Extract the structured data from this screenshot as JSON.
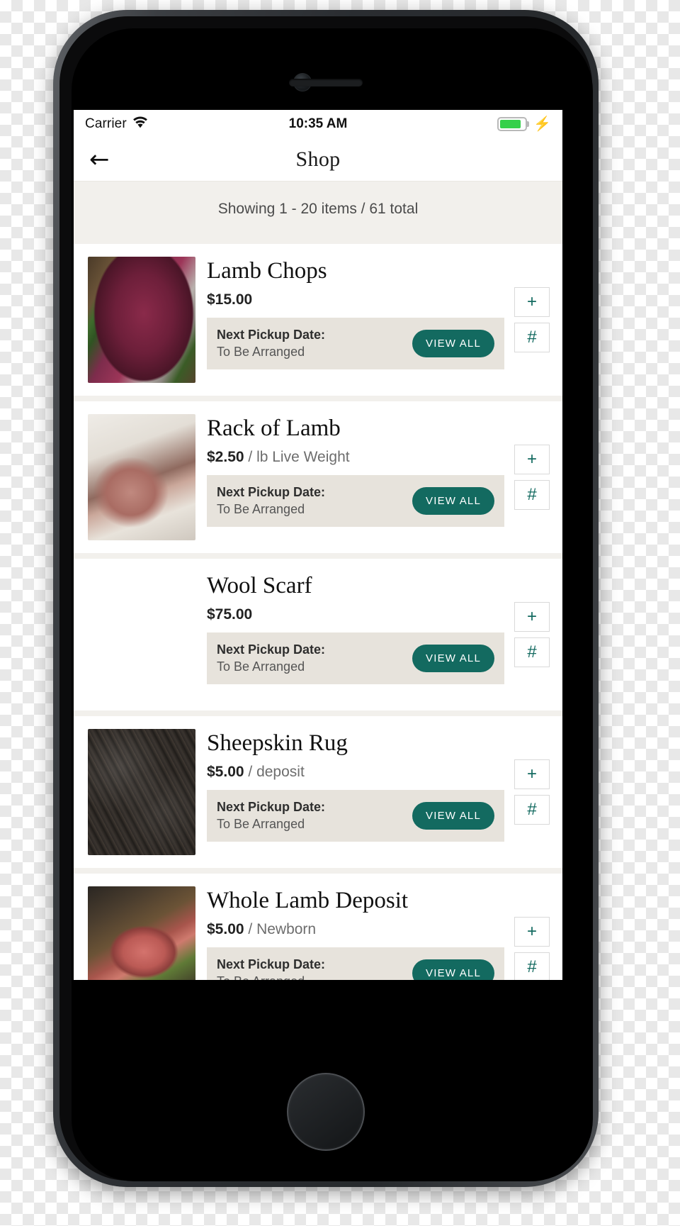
{
  "status_bar": {
    "carrier": "Carrier",
    "wifi_icon": "wifi-icon",
    "time": "10:35 AM",
    "battery_icon": "battery-icon",
    "battery_level_percent": 85,
    "charging_icon": "lightning-bolt-icon"
  },
  "nav": {
    "back_icon": "back-arrow-icon",
    "title": "Shop"
  },
  "listing": {
    "showing_text": "Showing 1 - 20 items / 61 total",
    "showing_from": 1,
    "showing_to": 20,
    "total": 61
  },
  "labels": {
    "pickup_label": "Next Pickup Date:",
    "view_all": "VIEW ALL",
    "add_icon": "+",
    "hash_icon": "#"
  },
  "colors": {
    "accent_teal": "#136a60",
    "page_bg": "#f2f0ec",
    "pickup_bg": "#e7e3dc",
    "card_bg": "#ffffff",
    "battery_green": "#35d04a"
  },
  "products": [
    {
      "name": "Lamb Chops",
      "price": "$15.00",
      "unit": "",
      "pickup_label": "Next Pickup Date:",
      "pickup_value": "To Be Arranged",
      "view_all": "VIEW ALL",
      "image": "lamb-chops-photo"
    },
    {
      "name": "Rack of Lamb",
      "price": "$2.50",
      "unit": " / lb Live Weight",
      "pickup_label": "Next Pickup Date:",
      "pickup_value": "To Be Arranged",
      "view_all": "VIEW ALL",
      "image": "rack-of-lamb-photo"
    },
    {
      "name": "Wool Scarf",
      "price": "$75.00",
      "unit": "",
      "pickup_label": "Next Pickup Date:",
      "pickup_value": "To Be Arranged",
      "view_all": "VIEW ALL",
      "image": "wool-scarf-photo"
    },
    {
      "name": "Sheepskin Rug",
      "price": "$5.00",
      "unit": " / deposit",
      "pickup_label": "Next Pickup Date:",
      "pickup_value": "To Be Arranged",
      "view_all": "VIEW ALL",
      "image": "sheepskin-rug-photo"
    },
    {
      "name": "Whole Lamb Deposit",
      "price": "$5.00",
      "unit": " / Newborn",
      "pickup_label": "Next Pickup Date:",
      "pickup_value": "To Be Arranged",
      "view_all": "VIEW ALL",
      "image": "whole-lamb-deposit-photo"
    }
  ]
}
